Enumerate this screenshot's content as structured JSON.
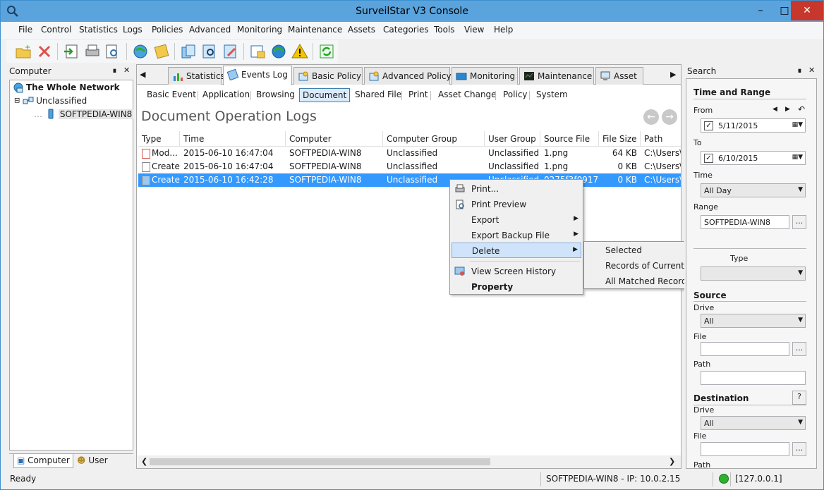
{
  "window": {
    "title": "SurveilStar V3 Console"
  },
  "menu": [
    "File",
    "Control",
    "Statistics",
    "Logs",
    "Policies",
    "Advanced",
    "Monitoring",
    "Maintenance",
    "Assets",
    "Categories",
    "Tools",
    "View",
    "Help"
  ],
  "left_panel": {
    "title": "Computer",
    "tree": [
      {
        "label": "The Whole Network"
      },
      {
        "label": "Unclassified"
      },
      {
        "label": "SOFTPEDIA-WIN8"
      }
    ],
    "tabs": [
      "Computer",
      "User"
    ]
  },
  "main_tabs": [
    "Statistics",
    "Events Log",
    "Basic Policy",
    "Advanced Policy",
    "Monitoring",
    "Maintenance",
    "Asset"
  ],
  "sub_tabs": [
    "Basic Event",
    "Application",
    "Browsing",
    "Document",
    "Shared File",
    "Print",
    "Asset Change",
    "Policy",
    "System"
  ],
  "heading": "Document Operation Logs",
  "grid": {
    "columns": [
      "Type",
      "Time",
      "Computer",
      "Computer Group",
      "User Group",
      "Source File",
      "File Size",
      "Path"
    ],
    "rows": [
      [
        "Mod...",
        "2015-06-10 16:47:04",
        "SOFTPEDIA-WIN8",
        "Unclassified",
        "Unclassified",
        "1.png",
        "64 KB",
        "C:\\Users\\"
      ],
      [
        "Create",
        "2015-06-10 16:47:04",
        "SOFTPEDIA-WIN8",
        "Unclassified",
        "Unclassified",
        "1.png",
        "0 KB",
        "C:\\Users\\"
      ],
      [
        "Create",
        "2015-06-10 16:42:28",
        "SOFTPEDIA-WIN8",
        "Unclassified",
        "Unclassified",
        "0275f3f0917...",
        "0 KB",
        "C:\\Users\\"
      ]
    ]
  },
  "context_menu": {
    "items": [
      "Print...",
      "Print Preview",
      "Export",
      "Export Backup File",
      "Delete",
      "View Screen History",
      "Property"
    ],
    "delete_submenu": [
      "Selected",
      "Records of Current Page",
      "All Matched Records"
    ]
  },
  "search_panel": {
    "title": "Search",
    "time_range_title": "Time and Range",
    "from_label": "From",
    "from_value": "5/11/2015",
    "to_label": "To",
    "to_value": "6/10/2015",
    "time_label": "Time",
    "time_value": "All Day",
    "range_label": "Range",
    "range_value": "SOFTPEDIA-WIN8",
    "type_fragment": "Type",
    "source_title": "Source",
    "drive_label": "Drive",
    "drive_value": "All",
    "file_label": "File",
    "path_label": "Path",
    "destination_title": "Destination",
    "help_glyph": "?",
    "dest_drive_label": "Drive",
    "dest_drive_value": "All",
    "dest_file_label": "File",
    "dest_path_label": "Path",
    "dots": "..."
  },
  "status": {
    "ready": "Ready",
    "connection": "SOFTPEDIA-WIN8 - IP: 10.0.2.15",
    "server": "[127.0.0.1]"
  },
  "colors": {
    "titlebar": "#5aa3dc",
    "selection": "#3399ff",
    "close": "#c7372b",
    "online": "#2fb02f"
  }
}
